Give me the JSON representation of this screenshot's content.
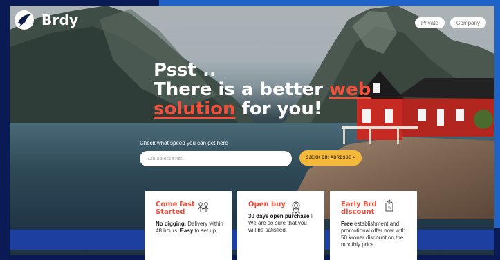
{
  "brand": {
    "name": "Brdy",
    "logo_icon": "bird-icon"
  },
  "nav": {
    "private_label": "Private",
    "company_label": "Company"
  },
  "hero": {
    "line1": "Psst ..",
    "line2_pre": "There is a better ",
    "line2_highlight": "web",
    "line3_highlight": "solution",
    "line3_post": " for you!",
    "highlight_color": "#f0513d"
  },
  "search": {
    "label": "Check what speed you can get here",
    "placeholder": "Din adresse her..",
    "button_label": "SJEKK DIN ADRESSE >",
    "button_color": "#f5b93a"
  },
  "cards": [
    {
      "title": "Come fast Started",
      "icon": "builders-icon",
      "body_bold1": "No digging.",
      "body_text1": " Delivery within 48 hours. ",
      "body_bold2": "Easy",
      "body_text2": " to set up."
    },
    {
      "title": "Open buy",
      "icon": "award-ribbon-icon",
      "body_bold1": "30 days open purchase",
      "body_text1": " ! We are so sure that you will be satisfied.",
      "body_bold2": "",
      "body_text2": ""
    },
    {
      "title": "Early Brd discount",
      "icon": "price-tag-icon",
      "body_bold1": "Free",
      "body_text1": " establishment and promotional offer now with 50 kroner discount on the monthly price.",
      "body_bold2": "",
      "body_text2": ""
    }
  ],
  "colors": {
    "frame": "#0a1a55",
    "band": "#1d3fa0",
    "accent": "#f0513d"
  }
}
